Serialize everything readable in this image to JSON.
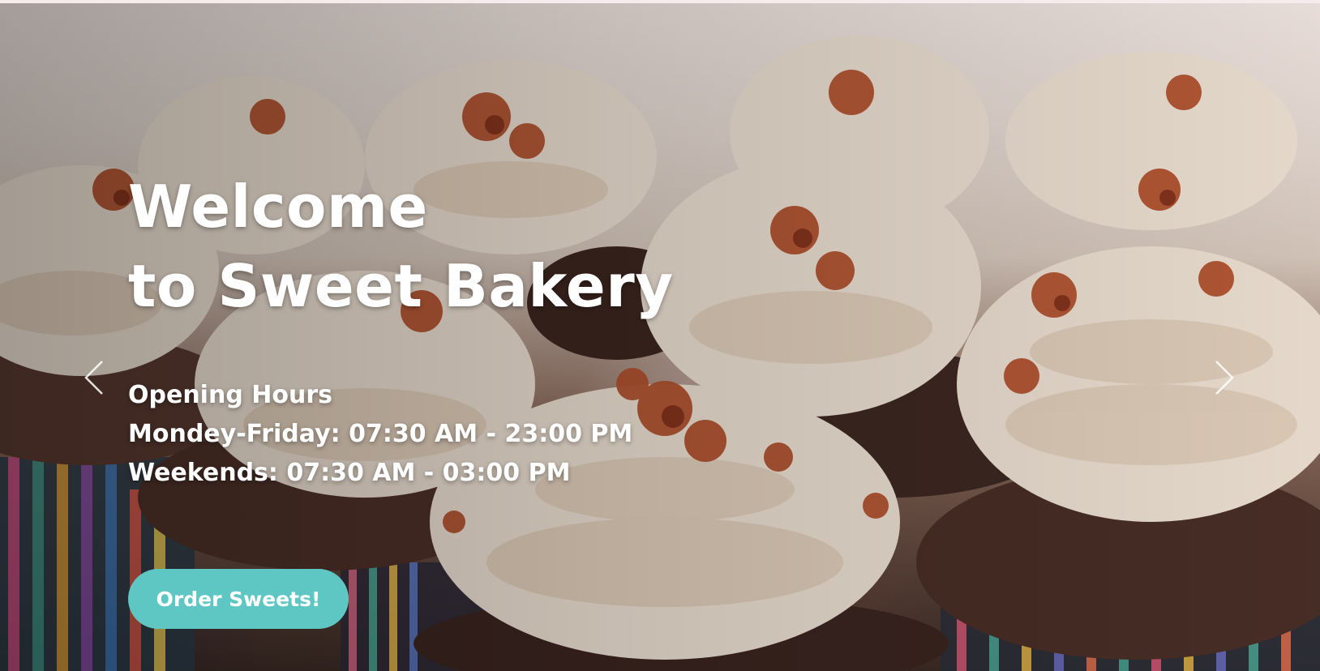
{
  "hero": {
    "title_line1": "Welcome",
    "title_line2": "to Sweet Bakery",
    "hours_heading": "Opening Hours",
    "hours_weekdays": "Mondey-Friday: 07:30 AM - 23:00 PM",
    "hours_weekends": "Weekends: 07:30 AM - 03:00 PM",
    "cta_label": "Order Sweets!",
    "background_image": "cupcakes-photo"
  },
  "carousel": {
    "prev_icon": "chevron-left-icon",
    "next_icon": "chevron-right-icon"
  },
  "colors": {
    "cta": "#5ec7c3",
    "text": "#ffffff",
    "frosting": "#f1e4d6",
    "cake": "#4a2d24",
    "topping": "#b4522e"
  }
}
